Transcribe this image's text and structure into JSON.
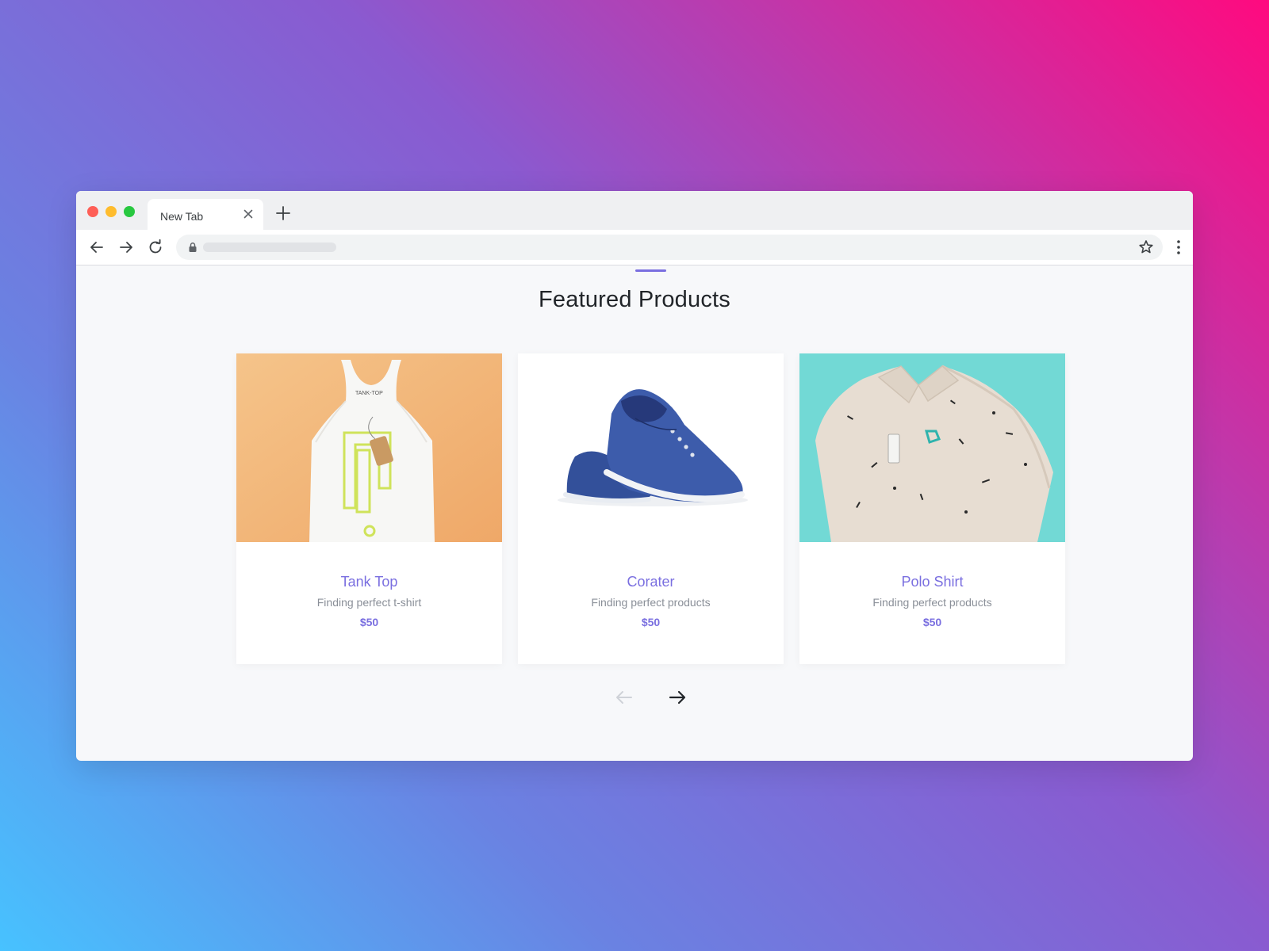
{
  "browser": {
    "tab_title": "New Tab",
    "icons": [
      "close-icon",
      "plus-icon",
      "arrow-left-icon",
      "arrow-right-icon",
      "reload-icon",
      "lock-icon",
      "star-icon",
      "kebab-menu-icon"
    ]
  },
  "section": {
    "heading": "Featured Products"
  },
  "products": [
    {
      "name": "Tank Top",
      "description": "Finding perfect t-shirt",
      "price": "$50",
      "image": "tank-top-photo"
    },
    {
      "name": "Corater",
      "description": "Finding perfect products",
      "price": "$50",
      "image": "blue-sneaker-photo"
    },
    {
      "name": "Polo Shirt",
      "description": "Finding perfect products",
      "price": "$50",
      "image": "polo-shirt-photo"
    }
  ],
  "carousel": {
    "prev_icon": "arrow-left-icon",
    "next_icon": "arrow-right-icon",
    "prev_disabled": true
  },
  "colors": {
    "accent": "#7a6fe0",
    "heading": "#212529",
    "muted": "#8a8f98"
  }
}
